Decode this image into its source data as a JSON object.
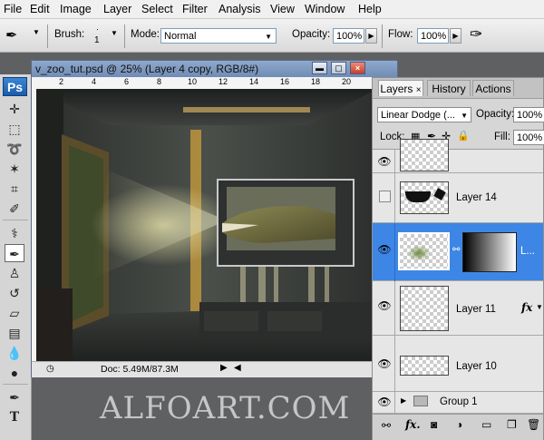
{
  "menu": [
    "File",
    "Edit",
    "Image",
    "Layer",
    "Select",
    "Filter",
    "Analysis",
    "View",
    "Window",
    "Help"
  ],
  "options": {
    "brush_label": "Brush:",
    "brush_size": "1",
    "mode_label": "Mode:",
    "mode_value": "Normal",
    "opacity_label": "Opacity:",
    "opacity_value": "100%",
    "flow_label": "Flow:",
    "flow_value": "100%"
  },
  "toolbox": {
    "logo": "Ps",
    "tools": [
      "move-icon",
      "marquee-icon",
      "lasso-icon",
      "magic-wand-icon",
      "crop-icon",
      "eyedropper-icon",
      "healing-icon",
      "brush-icon",
      "stamp-icon",
      "history-brush-icon",
      "eraser-icon",
      "gradient-icon",
      "blur-icon",
      "dodge-icon",
      "pen-icon",
      "type-icon"
    ]
  },
  "document": {
    "title": "v_zoo_tut.psd @ 25% (Layer 4 copy, RGB/8#)",
    "ruler_ticks": [
      "2",
      "4",
      "6",
      "8",
      "10",
      "12",
      "14",
      "16",
      "18",
      "20"
    ],
    "status": "Doc: 5.49M/87.3M"
  },
  "watermark": "ALFOART.COM",
  "layers_panel": {
    "tabs": [
      "Layers",
      "History",
      "Actions"
    ],
    "blend_mode": "Linear Dodge (...",
    "opacity_label": "Opacity:",
    "opacity_value": "100%",
    "lock_label": "Lock:",
    "fill_label": "Fill:",
    "fill_value": "100%",
    "rows": [
      {
        "name": "",
        "visible": true,
        "partial": true
      },
      {
        "name": "Layer 14",
        "visible": false
      },
      {
        "name": "L...",
        "visible": true,
        "selected": true
      },
      {
        "name": "Layer 11",
        "visible": true,
        "fx": "fx"
      },
      {
        "name": "Layer 10",
        "visible": true
      },
      {
        "name": "Group 1",
        "visible": true,
        "group": true
      }
    ],
    "footer_icons": [
      "link-icon",
      "fx-icon",
      "mask-icon",
      "adjustment-icon",
      "folder-icon",
      "new-layer-icon",
      "trash-icon"
    ]
  },
  "colors": {
    "accent": "#3d86e6",
    "title_bar": "#7f98bf"
  }
}
